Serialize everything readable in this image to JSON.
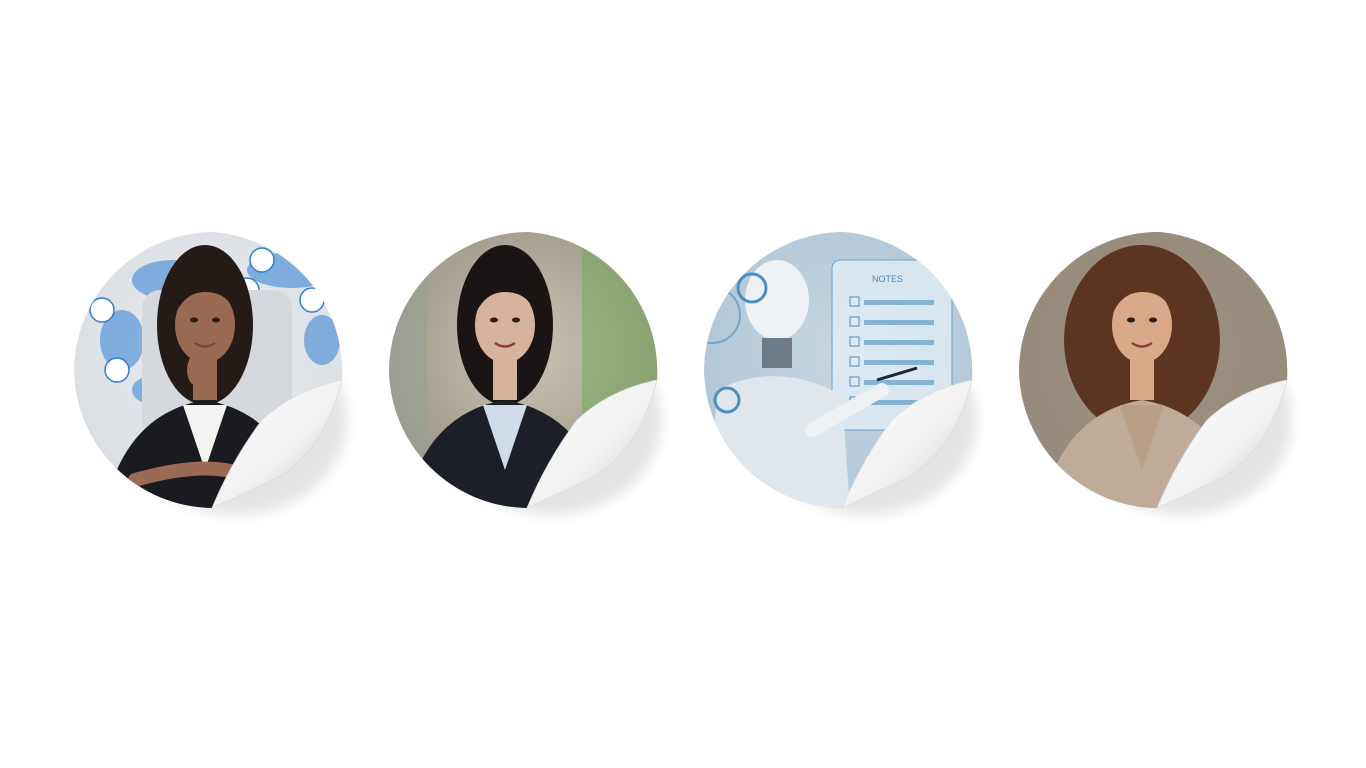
{
  "gallery": {
    "items": [
      {
        "id": "sticker-1",
        "subject": "woman-in-black-blazer-world-map-background",
        "colors": {
          "bg": "#e9eef4",
          "accent": "#2f7fd1",
          "skin": "#9a6a55",
          "hair": "#241a16",
          "blazer": "#1a1b20",
          "shirt": "#f3f3f1",
          "chair": "#d5d8dc"
        }
      },
      {
        "id": "sticker-2",
        "subject": "asian-woman-blurred-office-background",
        "colors": {
          "bg": "#c9c4b3",
          "accent": "#6aa84f",
          "skin": "#d7b39d",
          "hair": "#1b1414",
          "blazer": "#1c1f27",
          "shirt": "#cfdbe8",
          "chair": "#8a8577"
        }
      },
      {
        "id": "sticker-3",
        "subject": "humanoid-robot-holographic-notes",
        "label": "NOTES",
        "colors": {
          "bg": "#c6d7e3",
          "accent": "#4a8fc2",
          "skin": "#eef1f4",
          "hair": "#c7ced6",
          "blazer": "#dfe6ec",
          "shirt": "#9cb6cb",
          "chair": "#a8c0d2"
        }
      },
      {
        "id": "sticker-4",
        "subject": "woman-curly-brown-hair-smiling",
        "colors": {
          "bg": "#9e9182",
          "accent": "#c5a58c",
          "skin": "#d9a889",
          "hair": "#5c3522",
          "blazer": "#c0aa98",
          "shirt": "#b99e88",
          "chair": "#8a7d70"
        }
      }
    ]
  }
}
